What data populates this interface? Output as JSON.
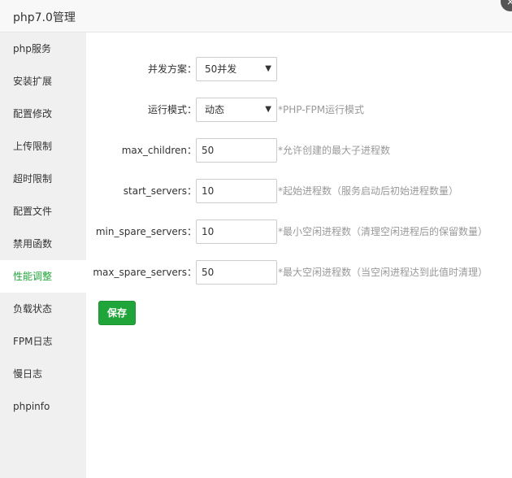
{
  "window": {
    "title": "php7.0管理",
    "close_glyph": "×"
  },
  "sidebar": {
    "items": [
      {
        "label": "php服务"
      },
      {
        "label": "安装扩展"
      },
      {
        "label": "配置修改"
      },
      {
        "label": "上传限制"
      },
      {
        "label": "超时限制"
      },
      {
        "label": "配置文件"
      },
      {
        "label": "禁用函数"
      },
      {
        "label": "性能调整"
      },
      {
        "label": "负载状态"
      },
      {
        "label": "FPM日志"
      },
      {
        "label": "慢日志"
      },
      {
        "label": "phpinfo"
      }
    ],
    "active_index": 7
  },
  "form": {
    "concurrency": {
      "label": "并发方案：",
      "value": "50并发"
    },
    "run_mode": {
      "label": "运行模式：",
      "value": "动态",
      "hint": "*PHP-FPM运行模式"
    },
    "max_children": {
      "label": "max_children：",
      "value": "50",
      "hint": "*允许创建的最大子进程数"
    },
    "start_servers": {
      "label": "start_servers：",
      "value": "10",
      "hint": "*起始进程数（服务启动后初始进程数量）"
    },
    "min_spare_servers": {
      "label": "min_spare_servers：",
      "value": "10",
      "hint": "*最小空闲进程数（清理空闲进程后的保留数量）"
    },
    "max_spare_servers": {
      "label": "max_spare_servers：",
      "value": "50",
      "hint": "*最大空闲进程数（当空闲进程达到此值时清理）"
    },
    "save_label": "保存"
  },
  "colors": {
    "accent": "#20a53a",
    "hint": "#999999",
    "sidebar_bg": "#f0f0f0"
  }
}
